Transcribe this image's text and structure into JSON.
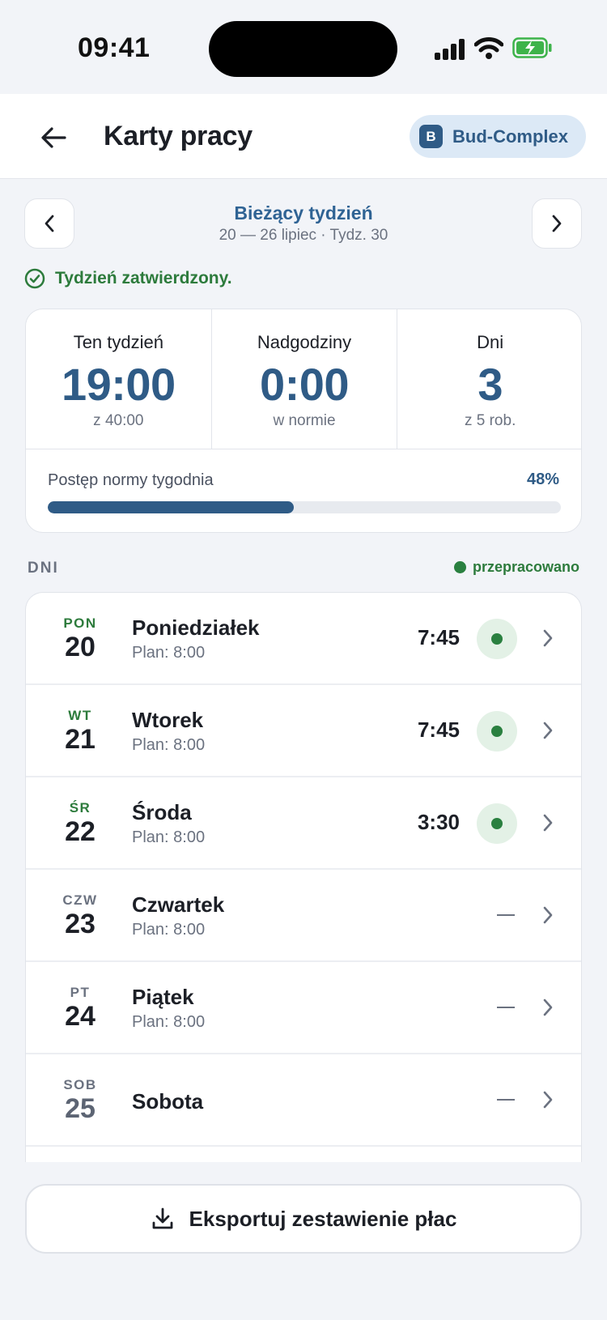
{
  "status_bar": {
    "time": "09:41"
  },
  "header": {
    "title": "Karty pracy",
    "company_initial": "B",
    "company_name": "Bud-Complex"
  },
  "week": {
    "title": "Bieżący tydzień",
    "subtitle": "20 — 26 lipiec · Tydz. 30",
    "approved_text": "Tydzień zatwierdzony."
  },
  "summary": {
    "stats": [
      {
        "label": "Ten tydzień",
        "value": "19:00",
        "sub": "z 40:00"
      },
      {
        "label": "Nadgodziny",
        "value": "0:00",
        "sub": "w normie"
      },
      {
        "label": "Dni",
        "value": "3",
        "sub": "z 5 rob."
      }
    ],
    "progress_label": "Postęp normy tygodnia",
    "progress_text": "48%",
    "progress_value": 0.48
  },
  "days_section": {
    "label": "DNI",
    "legend": "przepracowano"
  },
  "days": [
    {
      "abbr": "PON",
      "num": "20",
      "name": "Poniedziałek",
      "plan": "Plan: 8:00",
      "time": "7:45",
      "worked": true,
      "abbr_color": "#2d7b3c",
      "num_color": "#1c1f26"
    },
    {
      "abbr": "WT",
      "num": "21",
      "name": "Wtorek",
      "plan": "Plan: 8:00",
      "time": "7:45",
      "worked": true,
      "abbr_color": "#2d7b3c",
      "num_color": "#1c1f26"
    },
    {
      "abbr": "ŚR",
      "num": "22",
      "name": "Środa",
      "plan": "Plan: 8:00",
      "time": "3:30",
      "worked": true,
      "abbr_color": "#2d7b3c",
      "num_color": "#1c1f26"
    },
    {
      "abbr": "CZW",
      "num": "23",
      "name": "Czwartek",
      "plan": "Plan: 8:00",
      "time": "",
      "worked": false,
      "abbr_color": "#6b7280",
      "num_color": "#1c1f26"
    },
    {
      "abbr": "PT",
      "num": "24",
      "name": "Piątek",
      "plan": "Plan: 8:00",
      "time": "",
      "worked": false,
      "abbr_color": "#6b7280",
      "num_color": "#1c1f26"
    },
    {
      "abbr": "SOB",
      "num": "25",
      "name": "Sobota",
      "plan": "",
      "time": "",
      "worked": false,
      "abbr_color": "#6b7280",
      "num_color": "#5c6473"
    }
  ],
  "export": {
    "label": "Eksportuj zestawienie płac"
  },
  "colors": {
    "accent": "#2f5b86",
    "success": "#2a8040",
    "background": "#f2f4f8"
  }
}
